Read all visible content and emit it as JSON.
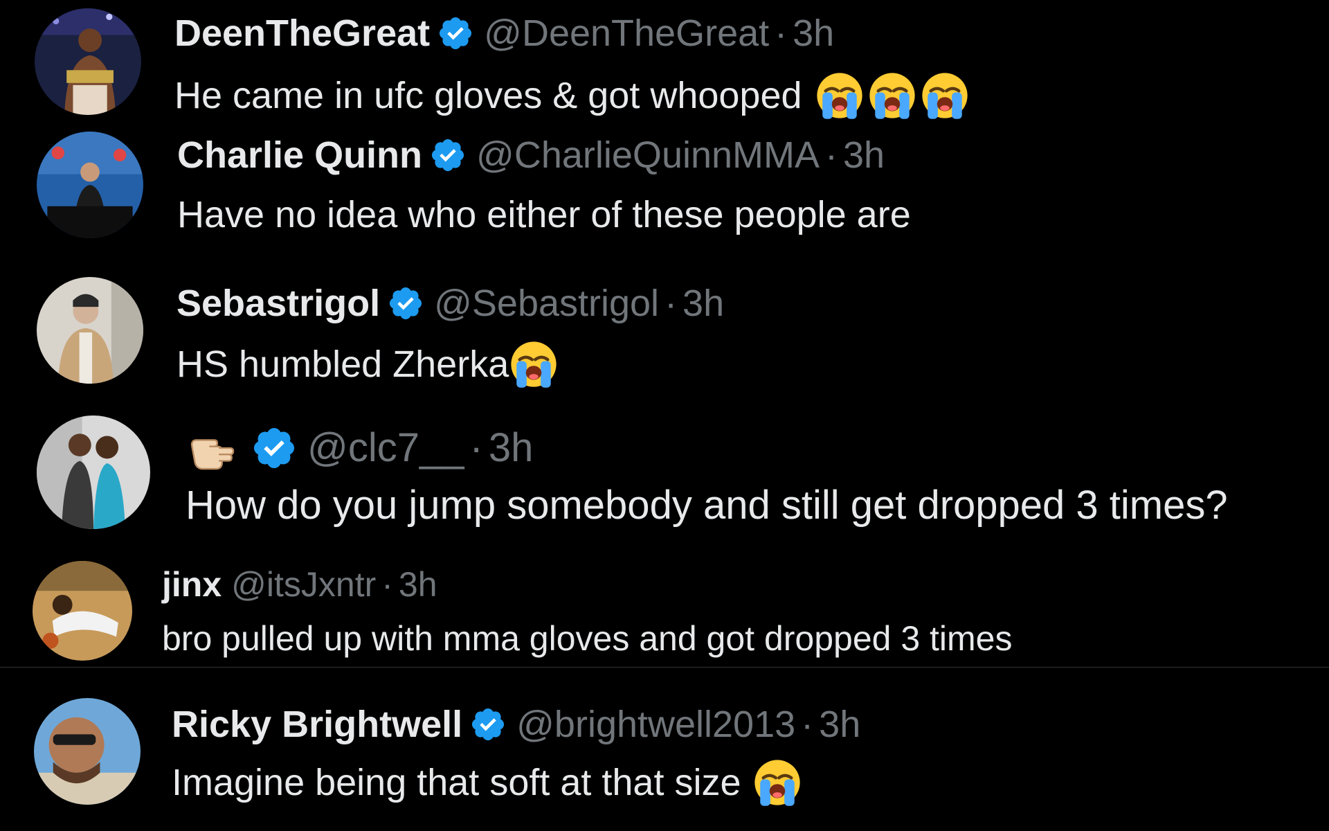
{
  "replies": [
    {
      "name": "DeenTheGreat",
      "verified": true,
      "handle": "@DeenTheGreat",
      "separator": "·",
      "time": "3h",
      "text": "He came in ufc gloves & got whooped",
      "emojis": [
        "loudly-crying-face",
        "loudly-crying-face",
        "loudly-crying-face"
      ]
    },
    {
      "name": "Charlie Quinn",
      "verified": true,
      "handle": "@CharlieQuinnMMA",
      "separator": "·",
      "time": "3h",
      "text": "Have no idea who either of these people are",
      "emojis": []
    },
    {
      "name": "Sebastrigol",
      "verified": true,
      "handle": "@Sebastrigol",
      "separator": "·",
      "time": "3h",
      "text": "HS humbled Zherka",
      "emojis": [
        "loudly-crying-face"
      ]
    },
    {
      "name": "",
      "name_emoji": "backhand-index-pointing-left",
      "verified": true,
      "handle": "@clc7__",
      "separator": "·",
      "time": "3h",
      "text": "How do you jump somebody and still get dropped 3 times?",
      "emojis": []
    },
    {
      "name": "jinx",
      "verified": false,
      "handle": "@itsJxntr",
      "separator": "·",
      "time": "3h",
      "text": "bro pulled up with mma gloves and got dropped 3 times",
      "emojis": []
    },
    {
      "name": "Ricky Brightwell",
      "verified": true,
      "handle": "@brightwell2013",
      "separator": "·",
      "time": "3h",
      "text": "Imagine being that soft at that size",
      "emojis": [
        "loudly-crying-face"
      ]
    }
  ],
  "colors": {
    "background": "#000000",
    "text_primary": "#e7e9ea",
    "text_secondary": "#71767b",
    "verified_badge": "#1d9bf0",
    "divider": "#2f3336"
  }
}
